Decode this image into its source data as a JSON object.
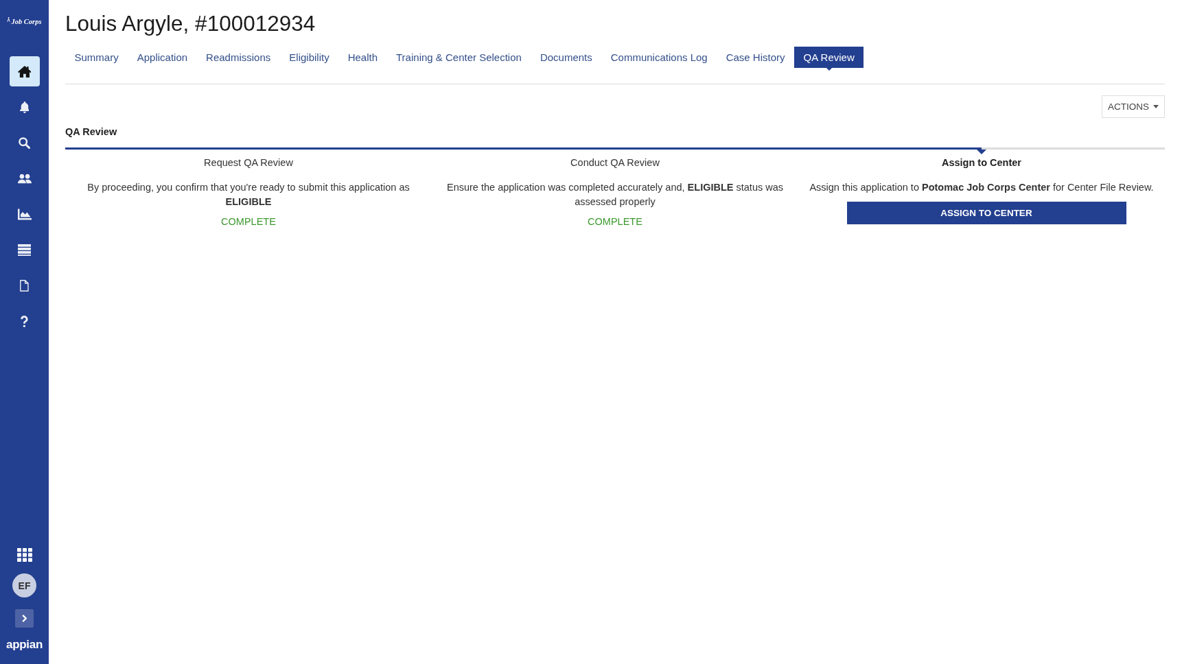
{
  "sidebar": {
    "logo": "Job Corps",
    "nav_items": [
      {
        "kind": "home",
        "selected": true
      },
      {
        "kind": "alerts",
        "selected": false
      },
      {
        "kind": "search",
        "selected": false
      },
      {
        "kind": "people",
        "selected": false
      },
      {
        "kind": "reports",
        "selected": false
      },
      {
        "kind": "records",
        "selected": false
      },
      {
        "kind": "documents",
        "selected": false
      },
      {
        "kind": "help",
        "selected": false
      }
    ],
    "avatar": "EF",
    "brand": "appian"
  },
  "header": {
    "title": "Louis Argyle, #100012934"
  },
  "tabs": [
    {
      "label": "Summary",
      "selected": false
    },
    {
      "label": "Application",
      "selected": false
    },
    {
      "label": "Readmissions",
      "selected": false
    },
    {
      "label": "Eligibility",
      "selected": false
    },
    {
      "label": "Health",
      "selected": false
    },
    {
      "label": "Training & Center Selection",
      "selected": false
    },
    {
      "label": "Documents",
      "selected": false
    },
    {
      "label": "Communications Log",
      "selected": false
    },
    {
      "label": "Case History",
      "selected": false
    },
    {
      "label": "QA Review",
      "selected": true
    }
  ],
  "actions_button": "ACTIONS",
  "section_title": "QA Review",
  "steps": [
    {
      "title": "Request QA Review",
      "current": false,
      "description": "By proceeding, you confirm that you're ready to submit this application as **ELIGIBLE**",
      "status": "COMPLETE"
    },
    {
      "title": "Conduct QA Review",
      "current": false,
      "description": "Ensure the application was completed accurately and, **ELIGIBLE** status was assessed properly",
      "status": "COMPLETE"
    },
    {
      "title": "Assign to Center",
      "current": true,
      "description": "Assign this application to **Potomac Job Corps Center** for Center File Review.",
      "button": "ASSIGN TO CENTER"
    }
  ]
}
